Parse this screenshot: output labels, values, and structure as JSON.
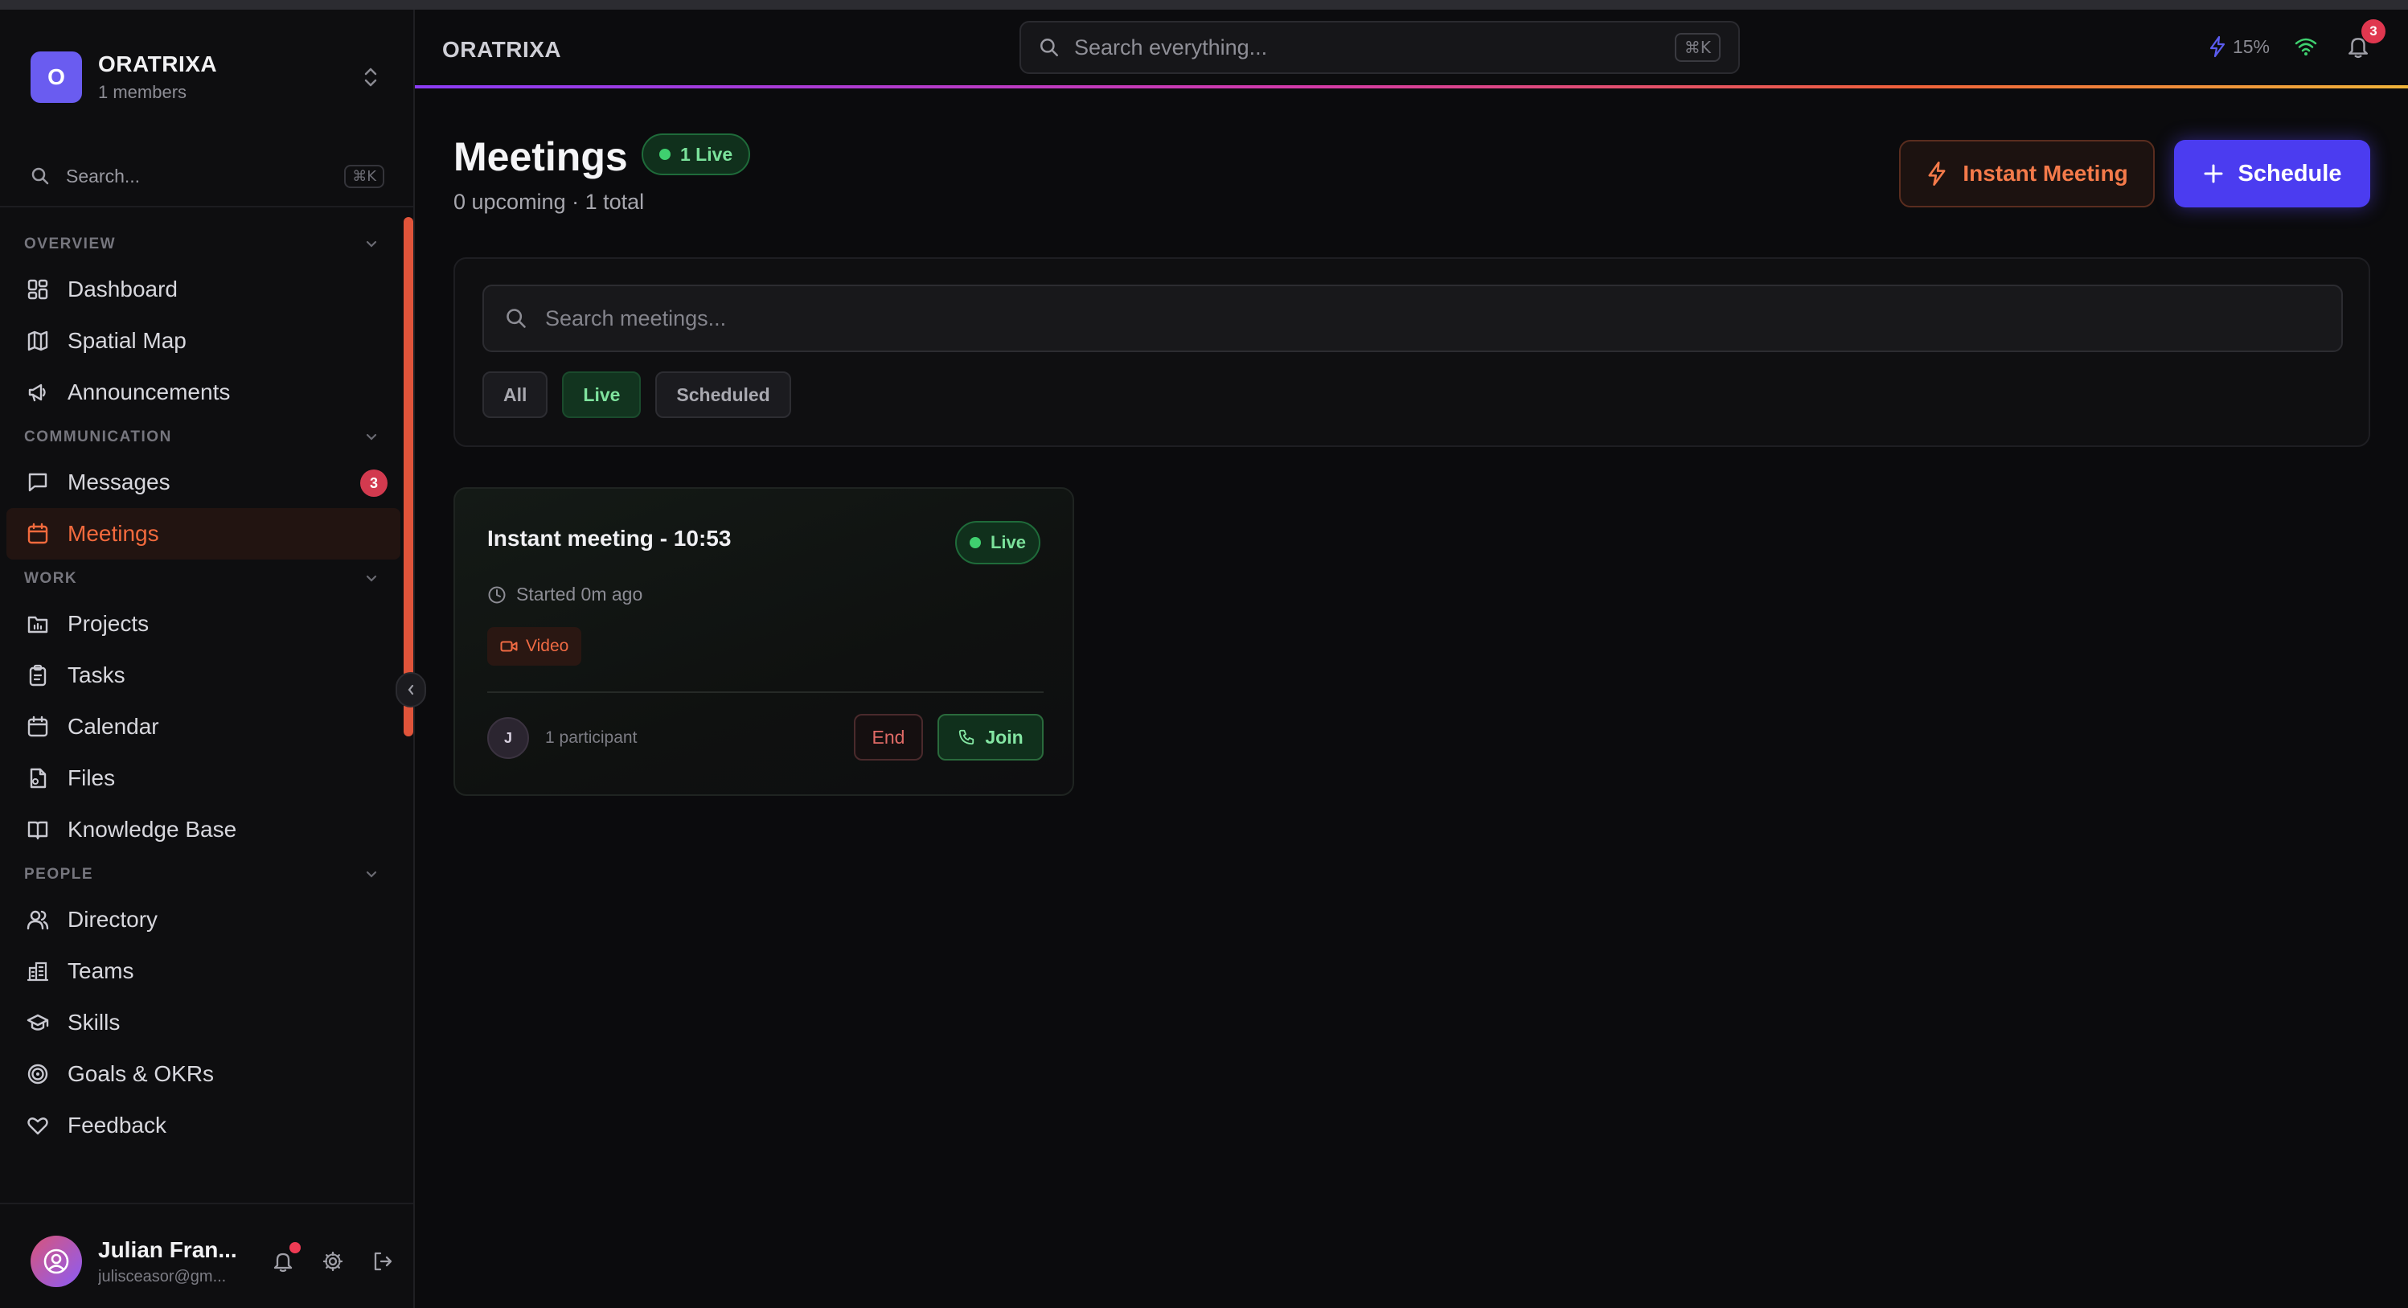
{
  "workspace": {
    "initial": "O",
    "name": "ORATRIXA",
    "members": "1 members"
  },
  "sidebar": {
    "search_placeholder": "Search...",
    "search_shortcut": "⌘K",
    "sections": {
      "overview": "OVERVIEW",
      "communication": "COMMUNICATION",
      "work": "WORK",
      "people": "PEOPLE"
    },
    "items": {
      "dashboard": "Dashboard",
      "spatial_map": "Spatial Map",
      "announcements": "Announcements",
      "messages": "Messages",
      "messages_badge": "3",
      "meetings": "Meetings",
      "projects": "Projects",
      "tasks": "Tasks",
      "calendar": "Calendar",
      "files": "Files",
      "knowledge_base": "Knowledge Base",
      "directory": "Directory",
      "teams": "Teams",
      "skills": "Skills",
      "goals": "Goals & OKRs",
      "feedback": "Feedback"
    }
  },
  "user": {
    "name": "Julian Fran...",
    "email": "julisceasor@gm..."
  },
  "topbar": {
    "app_title": "ORATRIXA",
    "search_placeholder": "Search everything...",
    "search_shortcut": "⌘K",
    "battery": "15%",
    "notification_count": "3"
  },
  "page": {
    "title": "Meetings",
    "live_badge": "1 Live",
    "subtitle": "0 upcoming · 1 total",
    "instant_button": "Instant Meeting",
    "schedule_button": "Schedule",
    "meeting_search_placeholder": "Search meetings...",
    "filters": {
      "all": "All",
      "live": "Live",
      "scheduled": "Scheduled"
    }
  },
  "meeting_card": {
    "title": "Instant meeting - 10:53",
    "status": "Live",
    "started": "Started 0m ago",
    "type": "Video",
    "participant_initial": "J",
    "participants": "1 participant",
    "end_button": "End",
    "join_button": "Join"
  },
  "colors": {
    "accent_orange": "#f26a3d",
    "primary": "#4b3cf0",
    "live_green": "#3fd06f",
    "badge_red": "#d23a4f"
  }
}
